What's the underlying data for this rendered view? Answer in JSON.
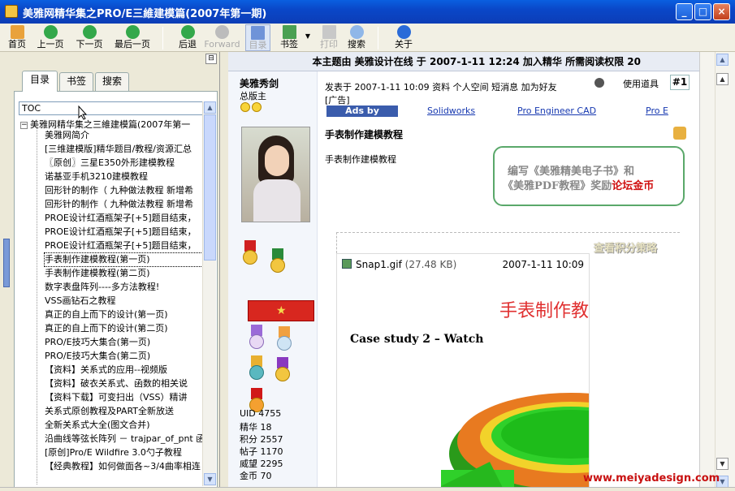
{
  "window": {
    "title": "美雅网精华集之PRO/E三維建模篇(2007年第一期)",
    "minimize": "_",
    "maximize": "□",
    "close": "×"
  },
  "toolbar": {
    "home": "首页",
    "prev": "上一页",
    "next": "下一页",
    "last": "最后一页",
    "back": "后退",
    "forward": "Forward",
    "toc": "目录",
    "bookmark": "书签",
    "print": "打印",
    "search": "搜索",
    "about": "关于"
  },
  "pane": {
    "tabs": [
      "目录",
      "书签",
      "搜索"
    ],
    "toc_field": "TOC",
    "root": "美雅网精华集之三維建模篇(2007年第一",
    "items": [
      "美雅网简介",
      "[三维建模版]精华题目/教程/资源汇总",
      "〖原创〗三星E350外形建模教程",
      "诺基亚手机3210建模教程",
      "回形针的制作（ 九种做法教程 新增希",
      "回形针的制作（ 九种做法教程 新增希",
      "PROE设计红酒瓶架子[+5]题目结束，",
      "PROE设计红酒瓶架子[+5]题目结束，",
      "PROE设计红酒瓶架子[+5]题目结束，",
      "手表制作建模教程(第一页)",
      "手表制作建模教程(第二页)",
      "数字表盘阵列----多方法教程!",
      "VSS画钻石之教程",
      "真正的自上而下的设计(第一页)",
      "真正的自上而下的设计(第二页)",
      "PRO/E技巧大集合(第一页)",
      "PRO/E技巧大集合(第二页)",
      "【资料】关系式的应用--视频版",
      "【资料】破衣关系式、函数的相关说",
      "【资料下载】可变扫出（VSS）精讲",
      "关系式原创教程及PART全新放送",
      "全新关系式大全(图文合并)",
      "沿曲线等弦长阵列 － trajpar_of_pnt 函",
      "[原创]Pro/E Wildfire 3.0勺子教程",
      "【经典教程】如何做面各~3/4曲率相连"
    ]
  },
  "thread": {
    "header": "本主题由 美雅设计在线 于 2007-1-11 12:24 加入精华   所需阅读权限 20"
  },
  "author": {
    "name": "美雅秀剑",
    "rank": "总版主",
    "rankbar_icon": "★",
    "stats": [
      "UID 4755",
      "精华 18",
      "积分 2557",
      "帖子 1170",
      "威望 2295",
      "金币 70"
    ]
  },
  "post": {
    "meta": "发表于 2007-1-11 10:09  资料  个人空间  短消息  加为好友",
    "tools": "使用道具",
    "number": "#1",
    "ad_label": "[广告]",
    "ads_google": "Ads by Google",
    "ad_links": [
      "Solidworks",
      "Pro Engineer CAD",
      "Pro E"
    ],
    "title": "手表制作建模教程",
    "body": "手表制作建模教程",
    "promo_line1": "编写《美雅精美电子书》和",
    "promo_line2a": "《美雅PDF教程》奖励",
    "promo_line2b": "论坛金币",
    "view_points": "查看积分策略"
  },
  "attachment": {
    "filename": "Snap1.gif",
    "size": "(27.48 KB)",
    "date": "2007-1-11 10:09",
    "heading": "手表制作教",
    "case_study": "Case study 2 – Watch"
  },
  "watermark": "www.meiyadesign.com",
  "colors": {
    "titlebar": "#0a47c8",
    "accent_red": "#d01010",
    "promo_border": "#5aa86a",
    "ads_bg": "#3a5cac"
  }
}
